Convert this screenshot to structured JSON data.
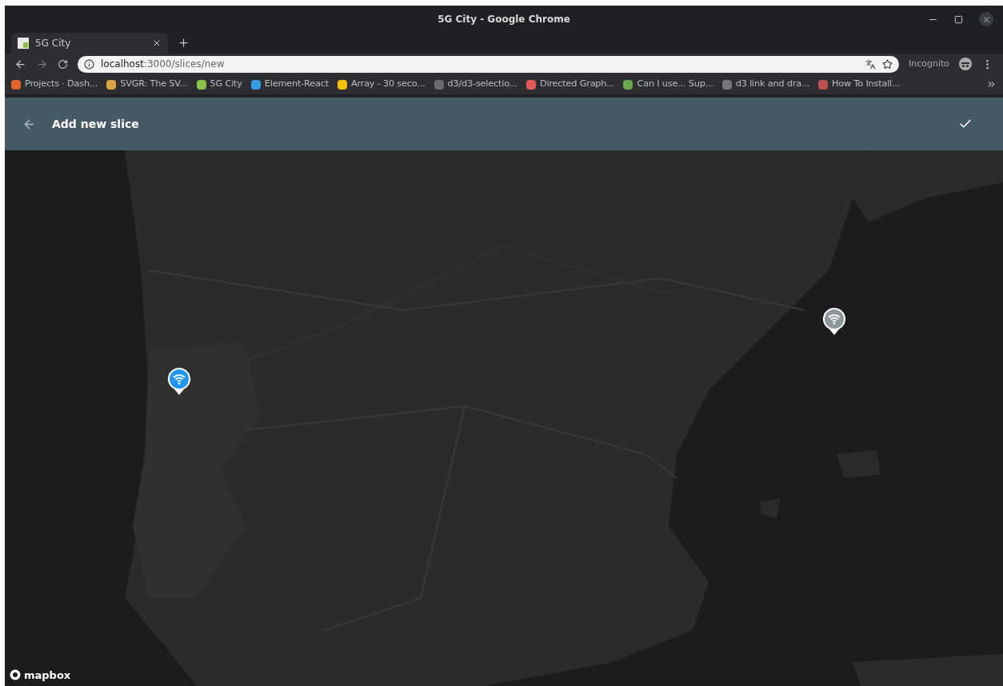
{
  "window": {
    "title": "5G City - Google Chrome"
  },
  "tabs": [
    {
      "label": "5G City",
      "selected": true
    }
  ],
  "address_bar": {
    "host": "localhost",
    "path": ":3000/slices/new",
    "profile": "Incognito"
  },
  "bookmarks": [
    {
      "label": "Projects · Dash..."
    },
    {
      "label": "SVGR: The SV..."
    },
    {
      "label": "5G City"
    },
    {
      "label": "Element-React"
    },
    {
      "label": "Array - 30 seco..."
    },
    {
      "label": "d3/d3-selectio..."
    },
    {
      "label": "Directed Graph..."
    },
    {
      "label": "Can I use... Sup..."
    },
    {
      "label": "d3 link and dra..."
    },
    {
      "label": "How To Install..."
    }
  ],
  "app_bar": {
    "title": "Add new slice"
  },
  "map": {
    "markers": [
      {
        "selected": true
      },
      {
        "selected": false
      }
    ],
    "attribution": "mapbox"
  }
}
